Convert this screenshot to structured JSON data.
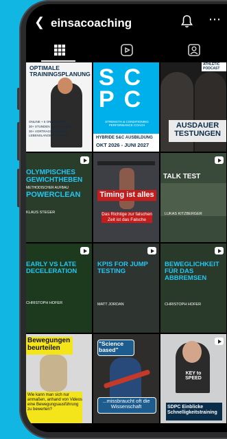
{
  "profile": {
    "username": "einsacoaching"
  },
  "tiles": [
    {
      "title": "OPTIMALE TRAININGSPLANUNG",
      "bullets": [
        "ONLINE + 5 ON DEMAND",
        "30+ STUNDEN MATERIALIEN",
        "30+ VORTRAGSBEREICHE",
        "LEBENSLANGER ZUGRIFF"
      ]
    },
    {
      "title": "SC PC",
      "subtitle": "STRENGTH & CONDITIONING PERFORMANCE COACH",
      "footer": "HYBRIDE S&C AUSBILDUNG",
      "dates": "OKT 2026 - JUNI 2027"
    },
    {
      "badge": "ATHLETIC PODCAST",
      "title": "AUSDAUER TESTUNGEN"
    },
    {
      "title": "OLYMPISCHES GEWICHTHEBEN",
      "subtitle": "METHODISCHER AUFBAU",
      "title2": "POWERCLEAN",
      "credit": "KLAUS STEGER"
    },
    {
      "title": "Timing ist alles",
      "caption": "Das Richtige zur falschen Zeit ist das Falsche"
    },
    {
      "title": "TALK TEST",
      "credit": "LUKAS KITZBERGER"
    },
    {
      "title": "EARLY VS LATE DECELERATION",
      "credit": "CHRISTOPH HOFER"
    },
    {
      "title": "KPIS FOR JUMP TESTING",
      "credit": "MATT JORDAN"
    },
    {
      "title": "BEWEGLICHKEIT FÜR DAS ABBREMSEN",
      "credit": "CHRISTOPH HOFER"
    },
    {
      "title": "Bewegungen beurteilen",
      "caption": "Wie kann man sich nur anmaßen, anhand von Videos eine Bewegungsausführung zu bewerten?"
    },
    {
      "title": "\"Science based\"",
      "caption": "...missbraucht oft die Wissenschaft"
    },
    {
      "badge": "KEY to SPEED",
      "caption": "SDPC Einblicke Schnelligkeitstraining"
    }
  ],
  "colors": {
    "accent": "#00b0ea",
    "phone_background": "#12b6e2"
  }
}
